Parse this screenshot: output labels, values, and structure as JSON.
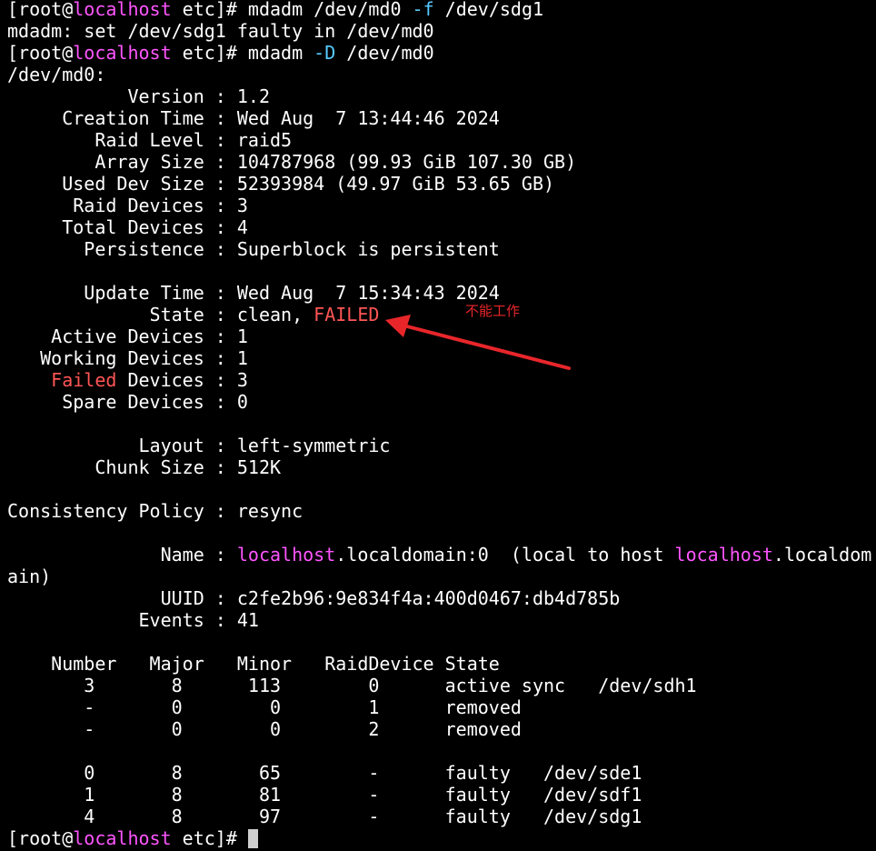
{
  "colors": {
    "background": "#000000",
    "text": "#ffffff",
    "hostname": "#ff55ff",
    "flag": "#55ccff",
    "failed": "#ff5555",
    "annotation": "#e8262a",
    "cursor": "#cfcfcf"
  },
  "lines": [
    {
      "segments": [
        {
          "t": "[root@"
        },
        {
          "t": "localhost",
          "c": "hostname"
        },
        {
          "t": " etc]# mdadm /dev/md0 "
        },
        {
          "t": "-f",
          "c": "flag"
        },
        {
          "t": " /dev/sdg1"
        }
      ]
    },
    {
      "segments": [
        {
          "t": "mdadm: set /dev/sdg1 faulty in /dev/md0"
        }
      ]
    },
    {
      "segments": [
        {
          "t": "[root@"
        },
        {
          "t": "localhost",
          "c": "hostname"
        },
        {
          "t": " etc]# mdadm "
        },
        {
          "t": "-D",
          "c": "flag"
        },
        {
          "t": " /dev/md0"
        }
      ]
    },
    {
      "segments": [
        {
          "t": "/dev/md0:"
        }
      ]
    },
    {
      "segments": [
        {
          "t": "           Version : 1.2"
        }
      ]
    },
    {
      "segments": [
        {
          "t": "     Creation Time : Wed Aug  7 13:44:46 2024"
        }
      ]
    },
    {
      "segments": [
        {
          "t": "        Raid Level : raid5"
        }
      ]
    },
    {
      "segments": [
        {
          "t": "        Array Size : 104787968 (99.93 GiB 107.30 GB)"
        }
      ]
    },
    {
      "segments": [
        {
          "t": "     Used Dev Size : 52393984 (49.97 GiB 53.65 GB)"
        }
      ]
    },
    {
      "segments": [
        {
          "t": "      Raid Devices : 3"
        }
      ]
    },
    {
      "segments": [
        {
          "t": "     Total Devices : 4"
        }
      ]
    },
    {
      "segments": [
        {
          "t": "       Persistence : Superblock is persistent"
        }
      ]
    },
    {
      "segments": [
        {
          "t": ""
        }
      ]
    },
    {
      "segments": [
        {
          "t": "       Update Time : Wed Aug  7 15:34:43 2024"
        }
      ]
    },
    {
      "segments": [
        {
          "t": "             State : clean, "
        },
        {
          "t": "FAILED",
          "c": "failed"
        }
      ]
    },
    {
      "segments": [
        {
          "t": "    Active Devices : 1"
        }
      ]
    },
    {
      "segments": [
        {
          "t": "   Working Devices : 1"
        }
      ]
    },
    {
      "segments": [
        {
          "t": "    "
        },
        {
          "t": "Failed",
          "c": "failed"
        },
        {
          "t": " Devices : 3"
        }
      ]
    },
    {
      "segments": [
        {
          "t": "     Spare Devices : 0"
        }
      ]
    },
    {
      "segments": [
        {
          "t": ""
        }
      ]
    },
    {
      "segments": [
        {
          "t": "            Layout : left-symmetric"
        }
      ]
    },
    {
      "segments": [
        {
          "t": "        Chunk Size : 512K"
        }
      ]
    },
    {
      "segments": [
        {
          "t": ""
        }
      ]
    },
    {
      "segments": [
        {
          "t": "Consistency Policy : resync"
        }
      ]
    },
    {
      "segments": [
        {
          "t": ""
        }
      ]
    },
    {
      "segments": [
        {
          "t": "              Name : "
        },
        {
          "t": "localhost",
          "c": "hostname"
        },
        {
          "t": ".localdomain:0  (local to host "
        },
        {
          "t": "localhost",
          "c": "hostname"
        },
        {
          "t": ".localdom"
        }
      ]
    },
    {
      "segments": [
        {
          "t": "ain)"
        }
      ]
    },
    {
      "segments": [
        {
          "t": "              UUID : c2fe2b96:9e834f4a:400d0467:db4d785b"
        }
      ]
    },
    {
      "segments": [
        {
          "t": "            Events : 41"
        }
      ]
    },
    {
      "segments": [
        {
          "t": ""
        }
      ]
    },
    {
      "segments": [
        {
          "t": "    Number   Major   Minor   RaidDevice State"
        }
      ]
    },
    {
      "segments": [
        {
          "t": "       3       8      113        0      active sync   /dev/sdh1"
        }
      ]
    },
    {
      "segments": [
        {
          "t": "       -       0        0        1      removed"
        }
      ]
    },
    {
      "segments": [
        {
          "t": "       -       0        0        2      removed"
        }
      ]
    },
    {
      "segments": [
        {
          "t": ""
        }
      ]
    },
    {
      "segments": [
        {
          "t": "       0       8       65        -      faulty   /dev/sde1"
        }
      ]
    },
    {
      "segments": [
        {
          "t": "       1       8       81        -      faulty   /dev/sdf1"
        }
      ]
    },
    {
      "segments": [
        {
          "t": "       4       8       97        -      faulty   /dev/sdg1"
        }
      ]
    },
    {
      "segments": [
        {
          "t": "[root@"
        },
        {
          "t": "localhost",
          "c": "hostname"
        },
        {
          "t": " etc]# "
        }
      ],
      "cursor": true
    }
  ],
  "annotation": {
    "note": "不能工作"
  }
}
